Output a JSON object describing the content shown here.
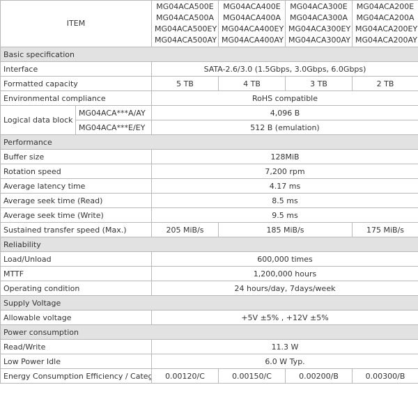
{
  "header": {
    "item_label": "ITEM",
    "models": [
      [
        "MG04ACA500E",
        "MG04ACA500A",
        "MG04ACA500EY",
        "MG04ACA500AY"
      ],
      [
        "MG04ACA400E",
        "MG04ACA400A",
        "MG04ACA400EY",
        "MG04ACA400AY"
      ],
      [
        "MG04ACA300E",
        "MG04ACA300A",
        "MG04ACA300EY",
        "MG04ACA300AY"
      ],
      [
        "MG04ACA200E",
        "MG04ACA200A",
        "MG04ACA200EY",
        "MG04ACA200AY"
      ]
    ]
  },
  "sections": {
    "basic": "Basic specification",
    "performance": "Performance",
    "reliability": "Reliability",
    "supply": "Supply Voltage",
    "power": "Power consumption"
  },
  "rows": {
    "interface": {
      "label": "Interface",
      "value": "SATA-2.6/3.0 (1.5Gbps, 3.0Gbps, 6.0Gbps)"
    },
    "capacity": {
      "label": "Formatted capacity",
      "values": [
        "5 TB",
        "4 TB",
        "3 TB",
        "2 TB"
      ]
    },
    "compliance": {
      "label": "Environmental compliance",
      "value": "RoHS compatible"
    },
    "block": {
      "label": "Logical data block length",
      "sub_a": "MG04ACA***A/AY",
      "value_a": "4,096 B",
      "sub_e": "MG04ACA***E/EY",
      "value_e": "512 B (emulation)"
    },
    "buffer": {
      "label": "Buffer size",
      "value": "128MiB"
    },
    "rotation": {
      "label": "Rotation speed",
      "value": "7,200 rpm"
    },
    "latency": {
      "label": "Average latency time",
      "value": "4.17 ms"
    },
    "seek_read": {
      "label": "Average seek time (Read)",
      "value": "8.5 ms"
    },
    "seek_write": {
      "label": "Average seek time (Write)",
      "value": "9.5 ms"
    },
    "transfer": {
      "label": "Sustained transfer speed (Max.)",
      "values": [
        "205 MiB/s",
        "185 MiB/s",
        "175 MiB/s"
      ]
    },
    "load": {
      "label": "Load/Unload",
      "value": "600,000 times"
    },
    "mttf": {
      "label": "MTTF",
      "value": "1,200,000 hours"
    },
    "operating": {
      "label": "Operating condition",
      "value": "24 hours/day, 7days/week"
    },
    "voltage": {
      "label": "Allowable voltage",
      "value": "+5V ±5% , +12V ±5%"
    },
    "read_write": {
      "label": "Read/Write",
      "value": "11.3 W"
    },
    "idle": {
      "label": "Low Power Idle",
      "value": "6.0 W Typ."
    },
    "efficiency": {
      "label": "Energy Consumption Efficiency / Category name",
      "values": [
        "0.00120/C",
        "0.00150/C",
        "0.00200/B",
        "0.00300/B"
      ]
    }
  }
}
